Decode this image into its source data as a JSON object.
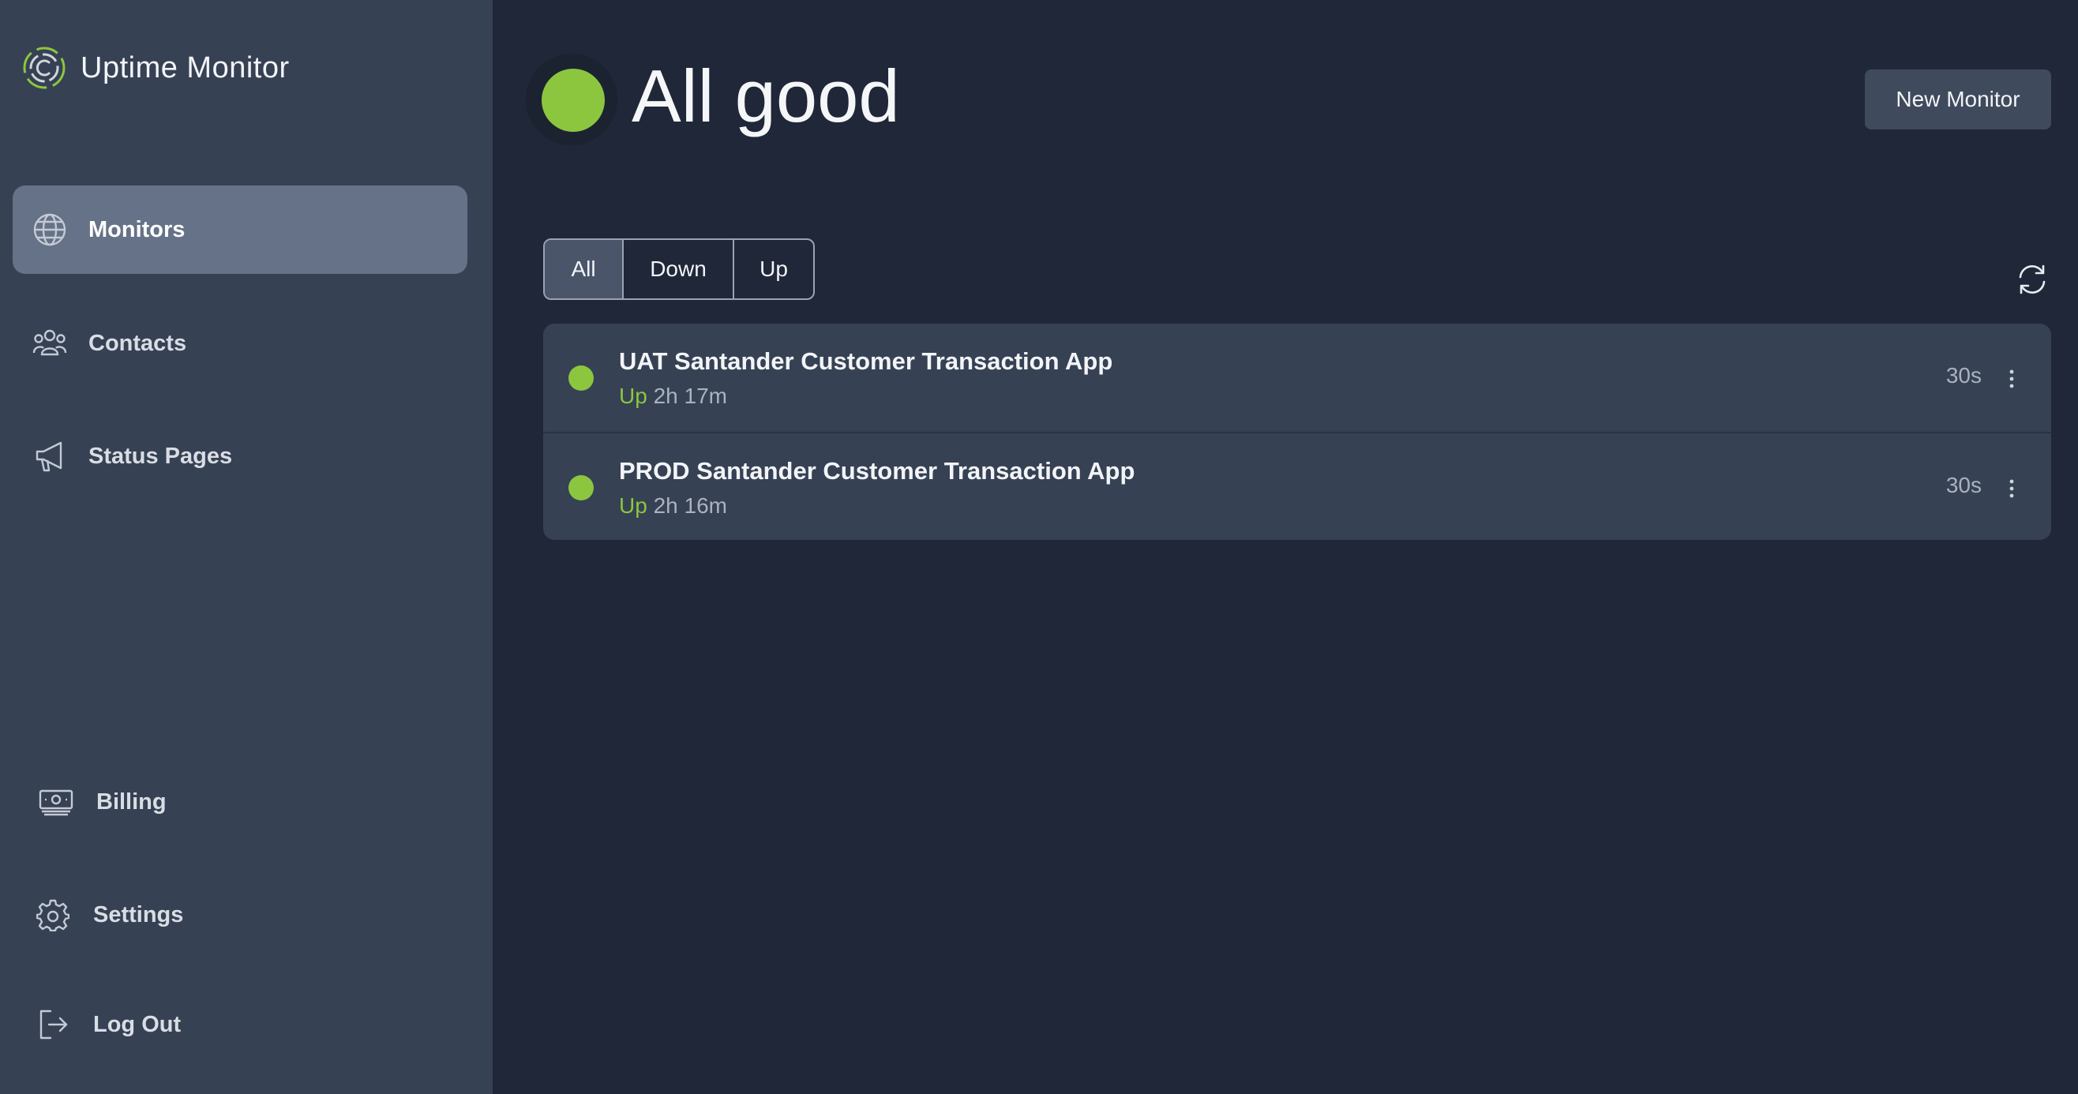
{
  "brand": {
    "name": "Uptime Monitor",
    "logo_icon": "logo-icon"
  },
  "sidebar": {
    "items": [
      {
        "label": "Monitors",
        "icon": "globe-icon",
        "active": true
      },
      {
        "label": "Contacts",
        "icon": "people-icon"
      },
      {
        "label": "Status Pages",
        "icon": "megaphone-icon"
      }
    ],
    "bottom_items": [
      {
        "label": "Billing",
        "icon": "money-icon"
      },
      {
        "label": "Settings",
        "icon": "gear-icon"
      },
      {
        "label": "Log Out",
        "icon": "logout-icon"
      }
    ]
  },
  "header": {
    "status_title": "All good",
    "new_monitor_label": "New Monitor"
  },
  "filters": {
    "all": "All",
    "down": "Down",
    "up": "Up",
    "selected": "All"
  },
  "monitors": [
    {
      "name": "UAT Santander Customer Transaction App",
      "state": "Up",
      "duration": "2h 17m",
      "interval": "30s"
    },
    {
      "name": "PROD Santander Customer Transaction App",
      "state": "Up",
      "duration": "2h 16m",
      "interval": "30s"
    }
  ],
  "colors": {
    "accent_green": "#8cc63f",
    "sidebar_bg": "#364154",
    "main_bg": "#1f2738",
    "active_nav": "#657287"
  }
}
